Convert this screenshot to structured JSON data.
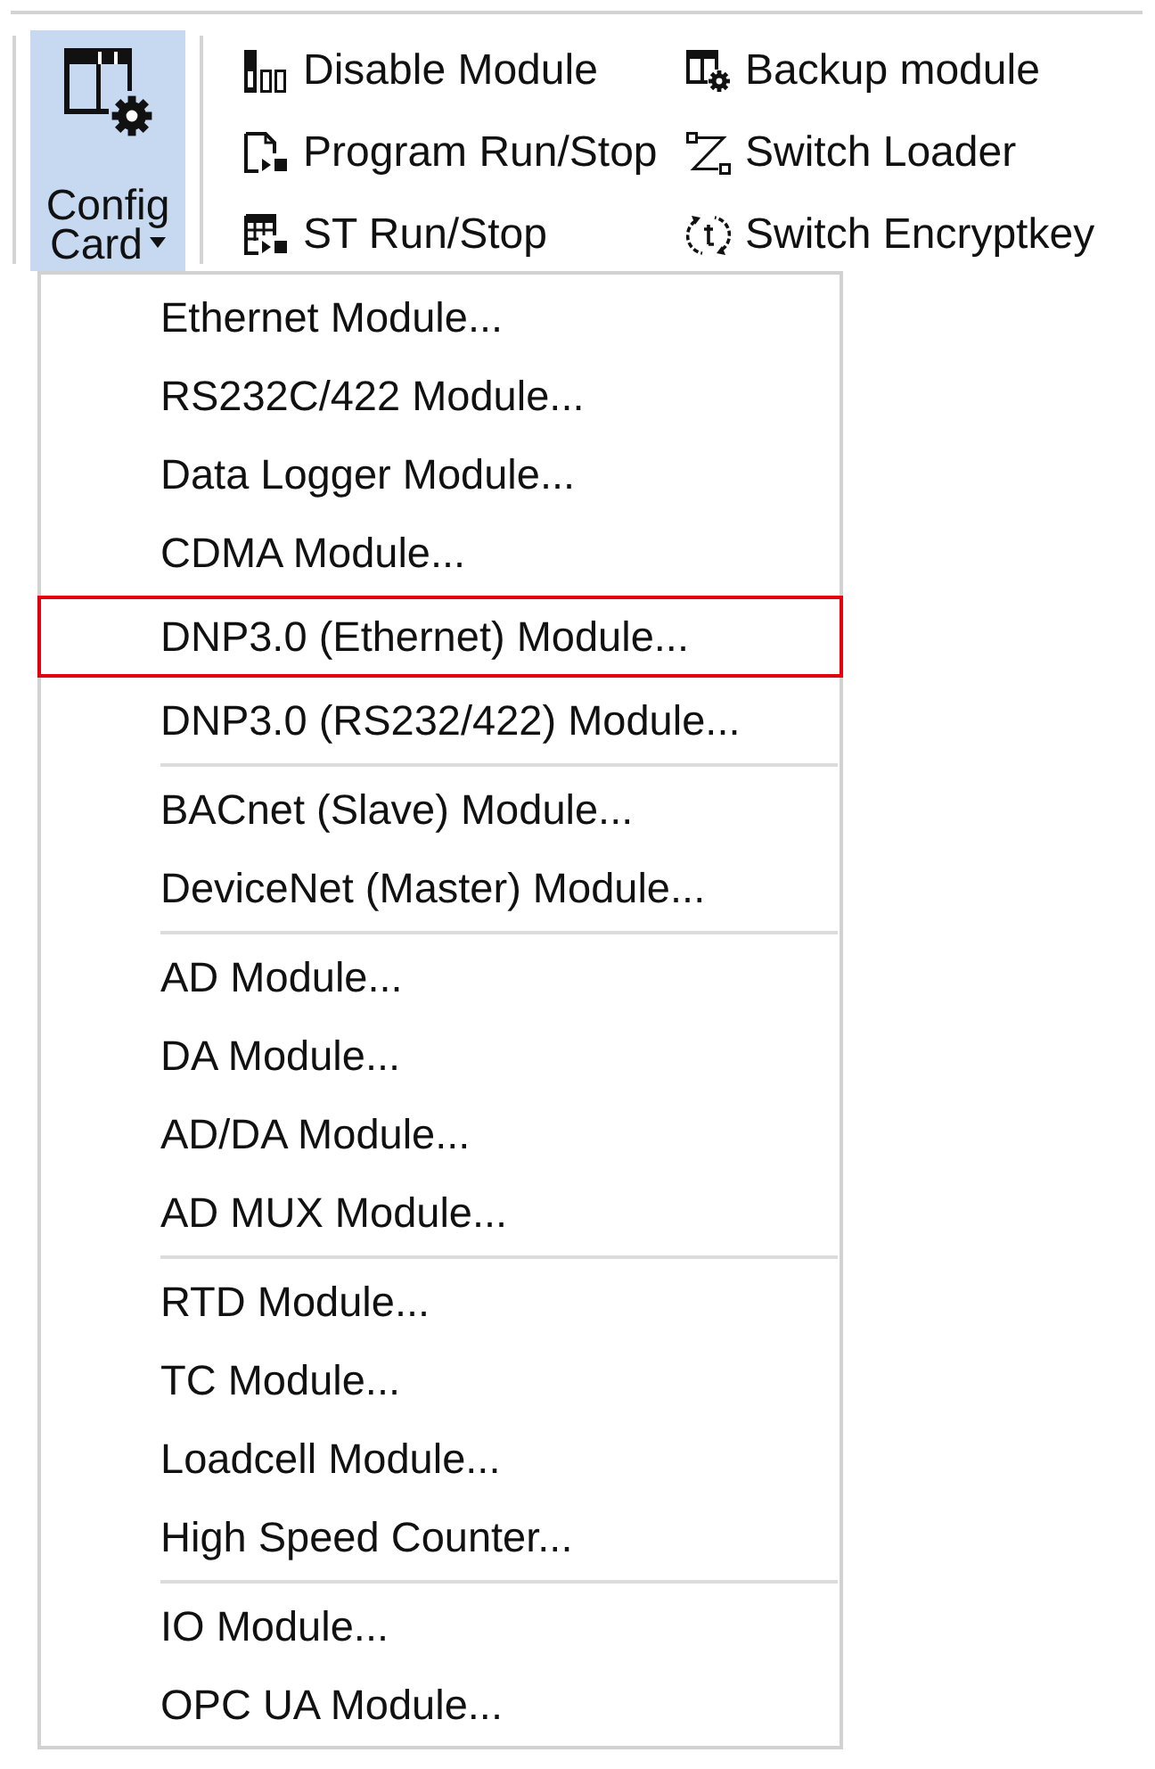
{
  "ribbon": {
    "config_card": {
      "label": "Config Card",
      "expanded": true
    },
    "commands": [
      {
        "kind": "disable",
        "label": "Disable Module"
      },
      {
        "kind": "backup",
        "label": "Backup module"
      },
      {
        "kind": "program",
        "label": "Program Run/Stop"
      },
      {
        "kind": "loader",
        "label": "Switch Loader"
      },
      {
        "kind": "st",
        "label": "ST Run/Stop"
      },
      {
        "kind": "encrypt",
        "label": "Switch Encryptkey"
      }
    ]
  },
  "menu": {
    "groups": [
      {
        "items": [
          {
            "label": "Ethernet Module...",
            "selected": false
          },
          {
            "label": "RS232C/422 Module...",
            "selected": false
          },
          {
            "label": "Data Logger Module...",
            "selected": false
          },
          {
            "label": "CDMA Module...",
            "selected": false
          },
          {
            "label": "DNP3.0 (Ethernet) Module...",
            "selected": true
          },
          {
            "label": "DNP3.0 (RS232/422) Module...",
            "selected": false
          }
        ]
      },
      {
        "items": [
          {
            "label": "BACnet (Slave) Module...",
            "selected": false
          },
          {
            "label": "DeviceNet (Master) Module...",
            "selected": false
          }
        ]
      },
      {
        "items": [
          {
            "label": "AD Module...",
            "selected": false
          },
          {
            "label": "DA Module...",
            "selected": false
          },
          {
            "label": "AD/DA Module...",
            "selected": false
          },
          {
            "label": "AD MUX Module...",
            "selected": false
          }
        ]
      },
      {
        "items": [
          {
            "label": "RTD Module...",
            "selected": false
          },
          {
            "label": "TC Module...",
            "selected": false
          },
          {
            "label": "Loadcell Module...",
            "selected": false
          },
          {
            "label": "High Speed Counter...",
            "selected": false
          }
        ]
      },
      {
        "items": [
          {
            "label": "IO Module...",
            "selected": false
          },
          {
            "label": "OPC UA Module...",
            "selected": false
          }
        ]
      }
    ]
  }
}
